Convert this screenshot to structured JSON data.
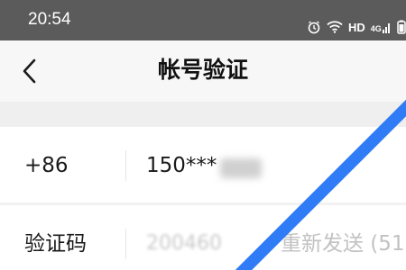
{
  "status_bar": {
    "time": "20:54",
    "hd_label": "HD",
    "network_label": "4G",
    "icons": [
      "alarm-icon",
      "wifi-icon",
      "signal-icon",
      "battery-icon"
    ]
  },
  "nav": {
    "title": "帐号验证",
    "back_icon": "chevron-left-icon"
  },
  "form": {
    "phone": {
      "country_code": "+86",
      "number": "150***"
    },
    "code": {
      "label": "验证码",
      "value": "200460",
      "resend_label": "重新发送 (51"
    }
  },
  "colors": {
    "status_bar_bg": "#5b5b5b",
    "annotation_stroke": "#2f7cf6",
    "disabled_text": "#c2c2c2"
  }
}
